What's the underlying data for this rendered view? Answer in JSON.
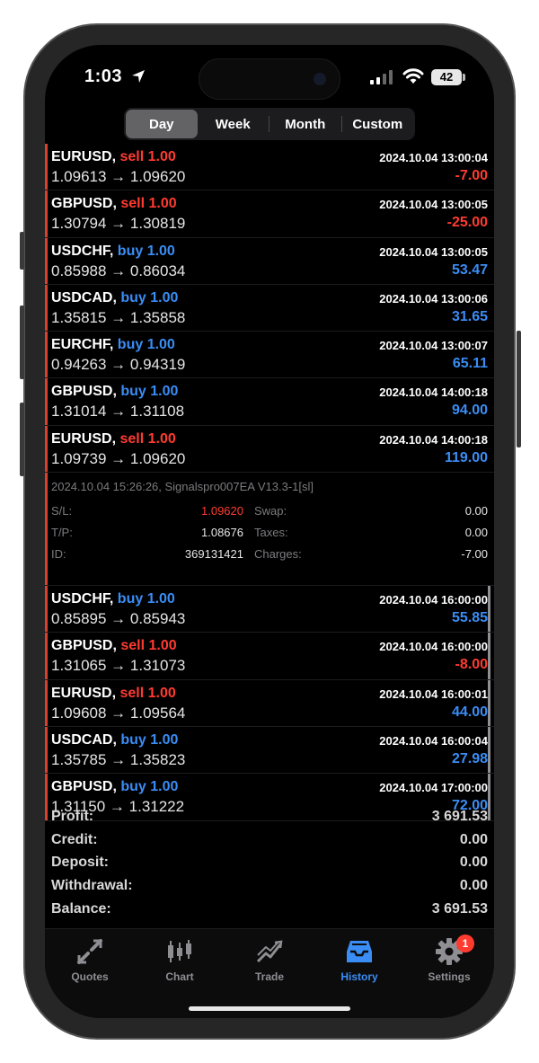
{
  "status_bar": {
    "time": "1:03",
    "battery": "42"
  },
  "period_tabs": [
    {
      "label": "Day",
      "active": true
    },
    {
      "label": "Week",
      "active": false
    },
    {
      "label": "Month",
      "active": false
    },
    {
      "label": "Custom",
      "active": false
    }
  ],
  "deals_top": [
    {
      "symbol": "EURUSD,",
      "side": "sell 1.00",
      "side_type": "sell",
      "time": "2024.10.04 13:00:04",
      "prices": "1.09613 → 1.09620",
      "profit": "-7.00",
      "profit_type": "neg"
    },
    {
      "symbol": "GBPUSD,",
      "side": "sell 1.00",
      "side_type": "sell",
      "time": "2024.10.04 13:00:05",
      "prices": "1.30794 → 1.30819",
      "profit": "-25.00",
      "profit_type": "neg"
    },
    {
      "symbol": "USDCHF,",
      "side": "buy 1.00",
      "side_type": "buy",
      "time": "2024.10.04 13:00:05",
      "prices": "0.85988 → 0.86034",
      "profit": "53.47",
      "profit_type": "pos"
    },
    {
      "symbol": "USDCAD,",
      "side": "buy 1.00",
      "side_type": "buy",
      "time": "2024.10.04 13:00:06",
      "prices": "1.35815 → 1.35858",
      "profit": "31.65",
      "profit_type": "pos"
    },
    {
      "symbol": "EURCHF,",
      "side": "buy 1.00",
      "side_type": "buy",
      "time": "2024.10.04 13:00:07",
      "prices": "0.94263 → 0.94319",
      "profit": "65.11",
      "profit_type": "pos"
    },
    {
      "symbol": "GBPUSD,",
      "side": "buy 1.00",
      "side_type": "buy",
      "time": "2024.10.04 14:00:18",
      "prices": "1.31014 → 1.31108",
      "profit": "94.00",
      "profit_type": "pos"
    },
    {
      "symbol": "EURUSD,",
      "side": "sell 1.00",
      "side_type": "sell",
      "time": "2024.10.04 14:00:18",
      "prices": "1.09739 → 1.09620",
      "profit": "119.00",
      "profit_type": "pos"
    }
  ],
  "expanded_detail": {
    "comment": "2024.10.04 15:26:26, Signalspro007EA V13.3-1[sl]",
    "sl_label": "S/L:",
    "sl_value": "1.09620",
    "swap_label": "Swap:",
    "swap_value": "0.00",
    "tp_label": "T/P:",
    "tp_value": "1.08676",
    "taxes_label": "Taxes:",
    "taxes_value": "0.00",
    "id_label": "ID:",
    "id_value": "369131421",
    "charges_label": "Charges:",
    "charges_value": "-7.00"
  },
  "deals_bottom": [
    {
      "symbol": "USDCHF,",
      "side": "buy 1.00",
      "side_type": "buy",
      "time": "2024.10.04 16:00:00",
      "prices": "0.85895 → 0.85943",
      "profit": "55.85",
      "profit_type": "pos"
    },
    {
      "symbol": "GBPUSD,",
      "side": "sell 1.00",
      "side_type": "sell",
      "time": "2024.10.04 16:00:00",
      "prices": "1.31065 → 1.31073",
      "profit": "-8.00",
      "profit_type": "neg"
    },
    {
      "symbol": "EURUSD,",
      "side": "sell 1.00",
      "side_type": "sell",
      "time": "2024.10.04 16:00:01",
      "prices": "1.09608 → 1.09564",
      "profit": "44.00",
      "profit_type": "pos"
    },
    {
      "symbol": "USDCAD,",
      "side": "buy 1.00",
      "side_type": "buy",
      "time": "2024.10.04 16:00:04",
      "prices": "1.35785 → 1.35823",
      "profit": "27.98",
      "profit_type": "pos"
    },
    {
      "symbol": "GBPUSD,",
      "side": "buy 1.00",
      "side_type": "buy",
      "time": "2024.10.04 17:00:00",
      "prices": "1.31150 → 1.31222",
      "profit": "72.00",
      "profit_type": "pos"
    }
  ],
  "summary": [
    {
      "label": "Profit:",
      "value": "3 691.53"
    },
    {
      "label": "Credit:",
      "value": "0.00"
    },
    {
      "label": "Deposit:",
      "value": "0.00"
    },
    {
      "label": "Withdrawal:",
      "value": "0.00"
    },
    {
      "label": "Balance:",
      "value": "3 691.53"
    }
  ],
  "tabbar": [
    {
      "label": "Quotes",
      "icon": "quotes-icon"
    },
    {
      "label": "Chart",
      "icon": "candlestick-icon"
    },
    {
      "label": "Trade",
      "icon": "trade-icon"
    },
    {
      "label": "History",
      "icon": "inbox-icon",
      "active": true
    },
    {
      "label": "Settings",
      "icon": "gear-icon",
      "badge": "1"
    }
  ],
  "colors": {
    "sell": "#ff3b30",
    "buy": "#3a8df5",
    "accent": "#3a8df5",
    "background": "#000000"
  }
}
